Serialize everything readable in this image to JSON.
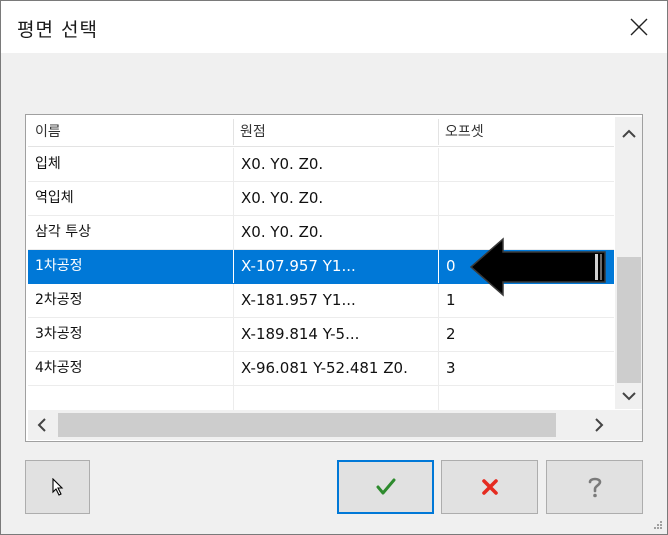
{
  "window": {
    "title": "평면 선택"
  },
  "table": {
    "columns": [
      "이름",
      "원점",
      "오프셋"
    ],
    "rows": [
      {
        "name": "입체",
        "origin": "X0. Y0. Z0.",
        "offset": ""
      },
      {
        "name": "역입체",
        "origin": "X0. Y0. Z0.",
        "offset": ""
      },
      {
        "name": "삼각 투상",
        "origin": "X0. Y0. Z0.",
        "offset": ""
      },
      {
        "name": "1차공정",
        "origin": "X-107.957 Y1...",
        "offset": "0",
        "selected": true
      },
      {
        "name": "2차공정",
        "origin": "X-181.957 Y1...",
        "offset": "1"
      },
      {
        "name": "3차공정",
        "origin": "X-189.814 Y-5...",
        "offset": "2"
      },
      {
        "name": "4차공정",
        "origin": "X-96.081 Y-52.481 Z0.",
        "offset": "3"
      }
    ]
  },
  "icons": {
    "close": "close-icon",
    "pointer": "cursor-arrow-icon",
    "ok": "checkmark-icon",
    "cancel": "x-mark-icon",
    "help": "question-mark-icon"
  },
  "colors": {
    "selection": "#0078d7",
    "ok_green": "#2e8b2e",
    "cancel_red": "#e52b20",
    "help_gray": "#7a7a7a"
  }
}
